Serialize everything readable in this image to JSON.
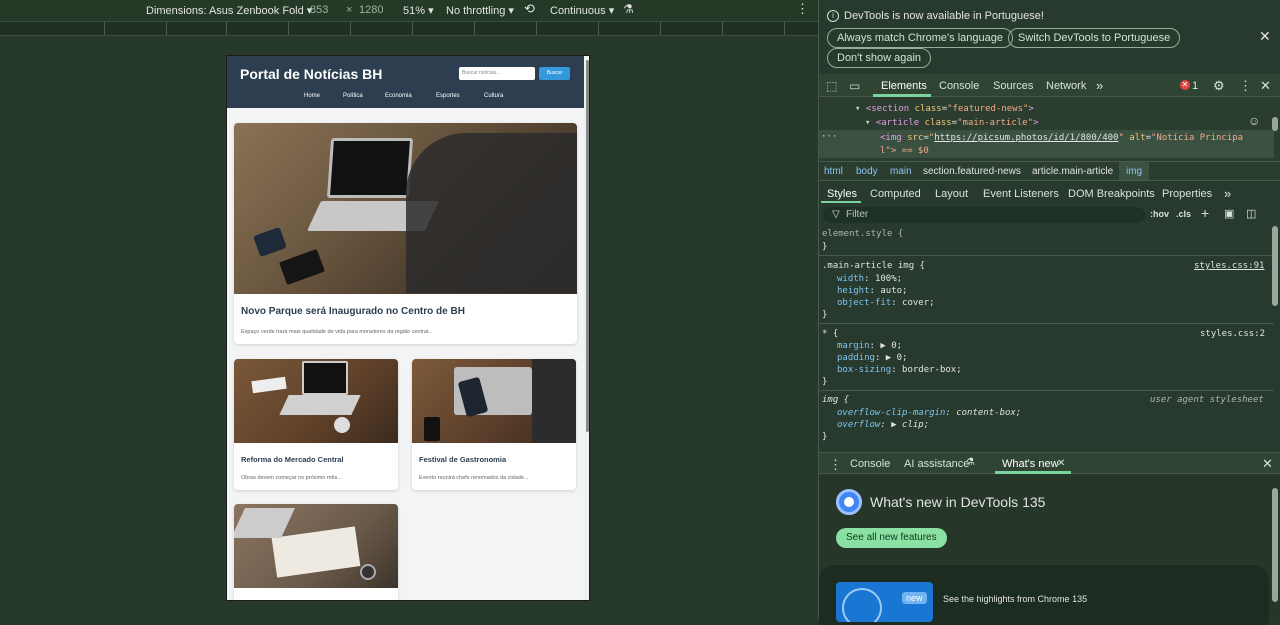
{
  "device_toolbar": {
    "dimensions": "Dimensions: Asus Zenbook Fold",
    "width": "853",
    "times": "×",
    "height": "1280",
    "zoom": "51%",
    "throttling": "No throttling",
    "mode": "Continuous"
  },
  "site": {
    "title": "Portal de Notícias BH",
    "search_placeholder": "Buscar notícias...",
    "search_button": "Buscar",
    "nav": [
      "Home",
      "Política",
      "Economia",
      "Esportes",
      "Cultura"
    ],
    "main_article": {
      "title": "Novo Parque será Inaugurado no Centro de BH",
      "desc": "Espaço verde trará mais qualidade de vida para moradores da região central..."
    },
    "articles": [
      {
        "title": "Reforma do Mercado Central",
        "desc": "Obras devem começar no próximo mês..."
      },
      {
        "title": "Festival de Gastronomia",
        "desc": "Evento reunirá chefs renomados da cidade..."
      }
    ]
  },
  "devtools": {
    "banner_text": "DevTools is now available in Portuguese!",
    "banner_buttons": [
      "Always match Chrome's language",
      "Switch DevTools to Portuguese",
      "Don't show again"
    ],
    "main_tabs": [
      "Elements",
      "Console",
      "Sources",
      "Network"
    ],
    "error_count": "1",
    "dom_lines": {
      "line1_tag": "<section",
      "line1_attr": "class",
      "line1_val": "\"featured-news\"",
      "line2_tag": "<article",
      "line2_attr": "class",
      "line2_val": "\"main-article\"",
      "line3_tag": "<img",
      "line3_attr1": "src",
      "line3_url": "https://picsum.photos/id/1/800/400",
      "line3_attr2": "alt",
      "line3_alt": "\"Notícia Principa",
      "line4": "l\"> == $0"
    },
    "breadcrumbs": [
      "html",
      "body",
      "main",
      "section.featured-news",
      "article.main-article",
      "img"
    ],
    "style_tabs": [
      "Styles",
      "Computed",
      "Layout",
      "Event Listeners",
      "DOM Breakpoints",
      "Properties"
    ],
    "filter_placeholder": "Filter",
    "hov": ":hov",
    "cls": ".cls",
    "rules": {
      "element_style": "element.style {",
      "close": "}",
      "rule1_selector": ".main-article img {",
      "rule1_source": "styles.css:91",
      "rule1_props": [
        [
          "width",
          "100%;"
        ],
        [
          "height",
          "auto;"
        ],
        [
          "object-fit",
          "cover;"
        ]
      ],
      "rule2_selector": "* {",
      "rule2_source": "styles.css:2",
      "rule2_props": [
        [
          "margin",
          "▶ 0;"
        ],
        [
          "padding",
          "▶ 0;"
        ],
        [
          "box-sizing",
          "border-box;"
        ]
      ],
      "rule3_selector": "img {",
      "rule3_source": "user agent stylesheet",
      "rule3_props": [
        [
          "overflow-clip-margin",
          "content-box;"
        ],
        [
          "overflow",
          "▶ clip;"
        ]
      ]
    },
    "drawer_tabs": [
      "Console",
      "AI assistance",
      "What's new"
    ],
    "whats_new_title": "What's new in DevTools 135",
    "see_all": "See all new features",
    "new_badge": "new",
    "highlights": "See the highlights from Chrome 135"
  }
}
